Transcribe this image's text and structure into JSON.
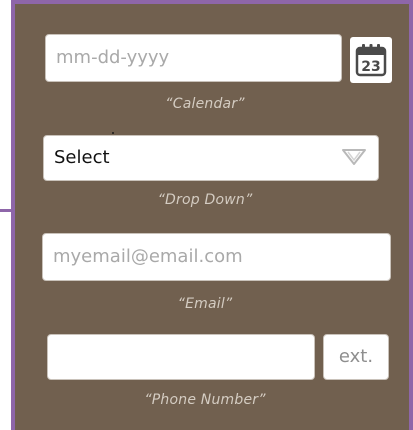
{
  "calendar": {
    "placeholder": "mm-dd-yyyy",
    "icon_day": "23",
    "icon_name": "calendar-icon",
    "caption": "“Calendar”"
  },
  "dropdown": {
    "value": "Select",
    "icon_name": "chevron-down-icon",
    "caption": "“Drop Down”"
  },
  "email": {
    "placeholder": "myemail@email.com",
    "caption": "“Email”"
  },
  "phone": {
    "value": "",
    "ext_placeholder": "ext.",
    "caption": "“Phone Number”"
  },
  "colors": {
    "panel_background": "#71604f",
    "border_accent": "#8e66a9",
    "caption_text": "#d4ccc2",
    "field_background": "#ffffff",
    "placeholder_text": "#a9a9a9"
  }
}
